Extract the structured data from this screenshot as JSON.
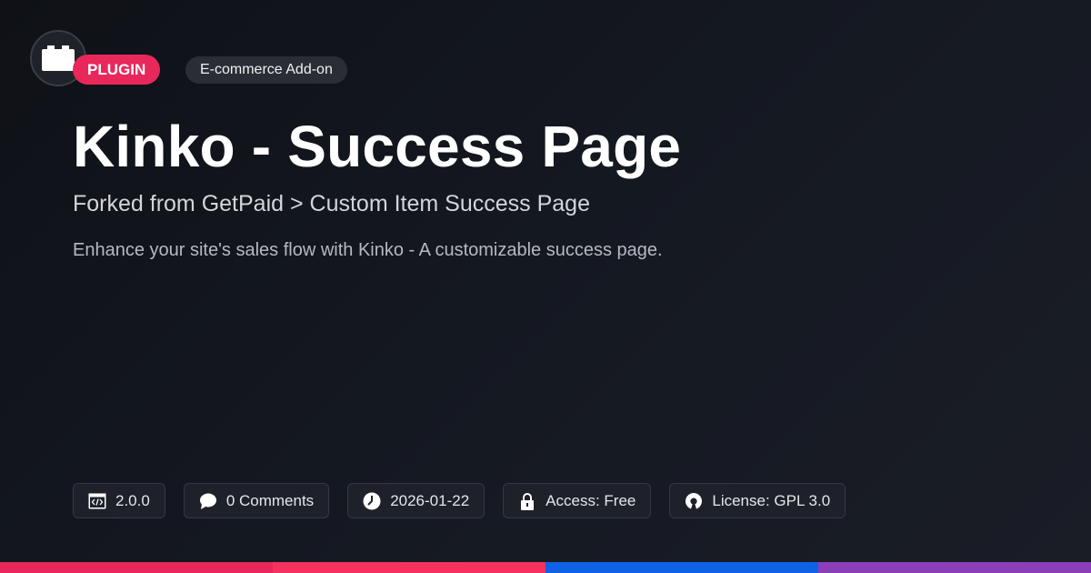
{
  "badges": {
    "type": "PLUGIN",
    "category": "E-commerce Add-on"
  },
  "title": "Kinko - Success Page",
  "subtitle": "Forked from GetPaid > Custom Item Success Page",
  "description": "Enhance your site's sales flow with Kinko - A customizable success page.",
  "meta": {
    "version": "2.0.0",
    "comments": "0 Comments",
    "date": "2026-01-22",
    "access": "Access: Free",
    "license": "License: GPL 3.0"
  },
  "icons": {
    "logo": "plugin-block-icon",
    "version": "code-window-icon",
    "comments": "speech-bubble-icon",
    "date": "clock-icon",
    "access": "lock-icon",
    "license": "open-source-icon"
  },
  "colors": {
    "accent": "#e8285a",
    "bar": [
      "#e8285a",
      "#f5325e",
      "#0f62e6",
      "#8a3fb8"
    ]
  }
}
